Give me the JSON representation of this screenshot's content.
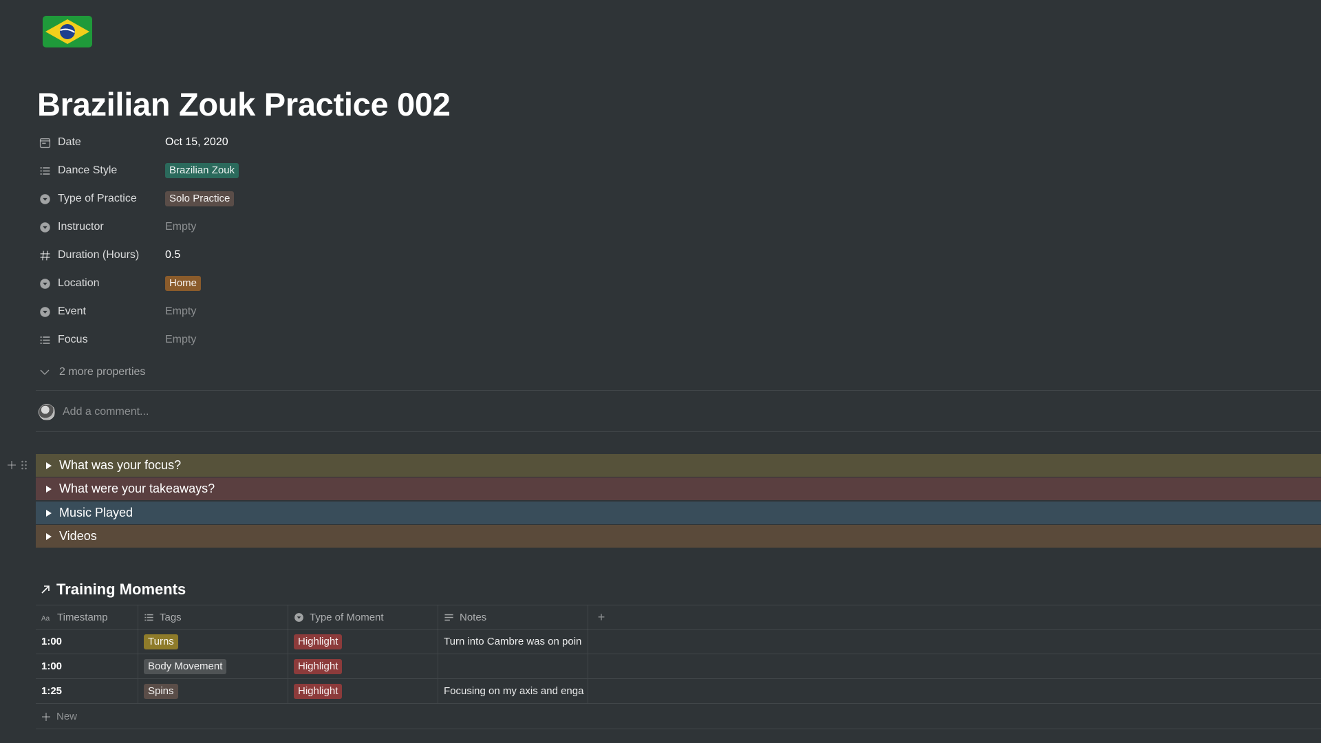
{
  "page": {
    "title": "Brazilian Zouk Practice 002",
    "icon": "brazil-flag-icon"
  },
  "properties": [
    {
      "label": "Date",
      "icon": "calendar-icon",
      "value": "Oct 15, 2020",
      "type": "text"
    },
    {
      "label": "Dance Style",
      "icon": "list-icon",
      "value": "Brazilian Zouk",
      "type": "tag",
      "color": "#2b6a5c"
    },
    {
      "label": "Type of Practice",
      "icon": "select-icon",
      "value": "Solo Practice",
      "type": "tag",
      "color": "#5a4d48"
    },
    {
      "label": "Instructor",
      "icon": "select-icon",
      "value": "Empty",
      "type": "empty"
    },
    {
      "label": "Duration (Hours)",
      "icon": "number-icon",
      "value": "0.5",
      "type": "text"
    },
    {
      "label": "Location",
      "icon": "select-icon",
      "value": "Home",
      "type": "tag",
      "color": "#8a5b2b"
    },
    {
      "label": "Event",
      "icon": "select-icon",
      "value": "Empty",
      "type": "empty"
    },
    {
      "label": "Focus",
      "icon": "list-icon",
      "value": "Empty",
      "type": "empty"
    }
  ],
  "more_properties": "2 more properties",
  "comment_placeholder": "Add a comment...",
  "toggles": [
    {
      "label": "What was your focus?",
      "color": "#56523a"
    },
    {
      "label": "What were your takeaways?",
      "color": "#5a3f40"
    },
    {
      "label": "Music Played",
      "color": "#394d5a"
    },
    {
      "label": "Videos",
      "color": "#5a4a3a"
    }
  ],
  "database": {
    "title": "Training Moments",
    "columns": [
      {
        "label": "Timestamp",
        "icon": "title-icon"
      },
      {
        "label": "Tags",
        "icon": "list-icon"
      },
      {
        "label": "Type of Moment",
        "icon": "select-icon"
      },
      {
        "label": "Notes",
        "icon": "text-icon"
      }
    ],
    "add_column_label": "+",
    "rows": [
      {
        "timestamp": "1:00",
        "tag": "Turns",
        "tag_color": "#8e7b2a",
        "moment": "Highlight",
        "moment_color": "#8c3b3b",
        "notes": "Turn into Cambre was on poin"
      },
      {
        "timestamp": "1:00",
        "tag": "Body Movement",
        "tag_color": "#4f5355",
        "moment": "Highlight",
        "moment_color": "#8c3b3b",
        "notes": ""
      },
      {
        "timestamp": "1:25",
        "tag": "Spins",
        "tag_color": "#5a4d48",
        "moment": "Highlight",
        "moment_color": "#8c3b3b",
        "notes": "Focusing on my axis and enga"
      }
    ],
    "new_label": "New"
  }
}
